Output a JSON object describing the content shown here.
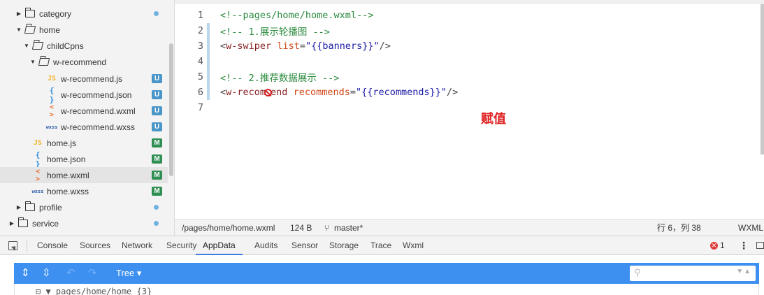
{
  "sidebar": {
    "items": [
      {
        "label": "category",
        "type": "folder",
        "indicator": "dot"
      },
      {
        "label": "home",
        "type": "folder-open"
      },
      {
        "label": "childCpns",
        "type": "folder-open"
      },
      {
        "label": "w-recommend",
        "type": "folder-open"
      },
      {
        "label": "w-recommend.js",
        "icon": "JS",
        "badge": "U"
      },
      {
        "label": "w-recommend.json",
        "icon": "{ }",
        "badge": "U"
      },
      {
        "label": "w-recommend.wxml",
        "icon": "< >",
        "badge": "U"
      },
      {
        "label": "w-recommend.wxss",
        "icon": "wxss",
        "badge": "U"
      },
      {
        "label": "home.js",
        "icon": "JS",
        "badge": "M"
      },
      {
        "label": "home.json",
        "icon": "{ }",
        "badge": "M"
      },
      {
        "label": "home.wxml",
        "icon": "< >",
        "badge": "M",
        "active": true
      },
      {
        "label": "home.wxss",
        "icon": "wxss",
        "badge": "M"
      },
      {
        "label": "profile",
        "type": "folder",
        "indicator": "dot"
      },
      {
        "label": "service",
        "type": "folder",
        "indicator": "dot"
      }
    ]
  },
  "editor": {
    "lines": [
      {
        "num": "1",
        "comment": "<!--pages/home/home.wxml-->"
      },
      {
        "num": "2",
        "comment": "<!-- 1.展示轮播图 -->"
      },
      {
        "num": "3",
        "open": "<",
        "tag": "w-swiper",
        "attr": "list",
        "eq": "=",
        "value": "\"{{banners}}\"",
        "close": "/>"
      },
      {
        "num": "4"
      },
      {
        "num": "5",
        "comment": "<!-- 2.推荐数据展示 -->"
      },
      {
        "num": "6",
        "open": "<",
        "tag_a": "w-recom",
        "tag_b": "end",
        "attr": "recommends",
        "eq": "=",
        "value": "\"{{recommends}}\"",
        "close": "/>"
      },
      {
        "num": "7"
      }
    ],
    "annotation": "赋值"
  },
  "statusbar": {
    "path": "/pages/home/home.wxml",
    "size": "124 B",
    "branch": "master*",
    "position": "行 6，列 38",
    "language": "WXML"
  },
  "devtools": {
    "tabs": [
      "Console",
      "Sources",
      "Network",
      "Security",
      "AppData",
      "Audits",
      "Sensor",
      "Storage",
      "Trace",
      "Wxml"
    ],
    "active_tab": "AppData",
    "error_count": "1"
  },
  "appdata": {
    "view_mode": "Tree ▾",
    "row_text": "⊟ ▼ pages/home/home {3}"
  },
  "colors": {
    "accent": "#3d8ff0",
    "badge_u": "#4a96c9",
    "badge_m": "#2f8f53",
    "annotation": "#e02020"
  }
}
